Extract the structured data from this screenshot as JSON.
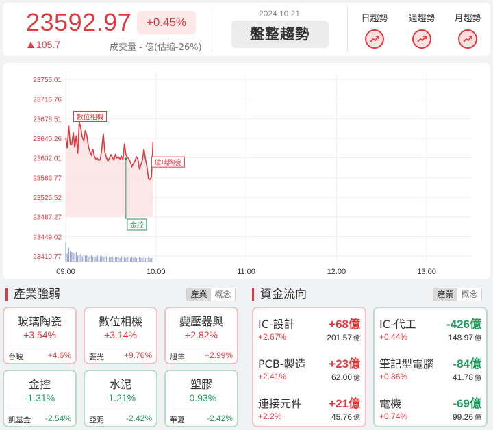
{
  "header": {
    "price": "23592.97",
    "change_pct": "+0.45%",
    "change": "105.7",
    "volume_text": "成交量 - 億(估縮-26%)",
    "date": "2024.10.21",
    "trend_label": "盤整趨勢",
    "trend_tabs": [
      {
        "label": "日趨勢"
      },
      {
        "label": "週趨勢"
      },
      {
        "label": "月趨勢"
      }
    ]
  },
  "colors": {
    "up": "#e0393e",
    "down": "#1f9a5c",
    "price_line": "#e0393e",
    "volume_bar": "#9aa6cf"
  },
  "chart_data": {
    "type": "line",
    "y_ticks": [
      "23755.01",
      "23716.76",
      "23678.51",
      "23640.26",
      "23602.01",
      "23563.77",
      "23525.52",
      "23487.27",
      "23449.02",
      "23410.77"
    ],
    "x_ticks": [
      "09:00",
      "10:00",
      "11:00",
      "12:00",
      "13:00"
    ],
    "ylim": [
      23410.77,
      23755.01
    ],
    "xlim": [
      0,
      270
    ],
    "series": [
      {
        "x": [
          0,
          1,
          2,
          3,
          4,
          5,
          6,
          7,
          8,
          9,
          10,
          11,
          12,
          13,
          14,
          15,
          16,
          17,
          18,
          19,
          20,
          21,
          22,
          23,
          24,
          25,
          26,
          27,
          28,
          29,
          30,
          31,
          32,
          33,
          34,
          35,
          36,
          37,
          38,
          39,
          40,
          41,
          42,
          43,
          44,
          45,
          46,
          47,
          48,
          49,
          50,
          51,
          52,
          53,
          54,
          55,
          56,
          57,
          58
        ],
        "values": [
          23641,
          23621,
          23665,
          23628,
          23628,
          23652,
          23622,
          23646,
          23610,
          23673,
          23660,
          23642,
          23635,
          23656,
          23647,
          23626,
          23615,
          23608,
          23620,
          23606,
          23600,
          23601,
          23597,
          23599,
          23620,
          23650,
          23613,
          23603,
          23596,
          23601,
          23608,
          23603,
          23598,
          23608,
          23602,
          23604,
          23600,
          23605,
          23598,
          23630,
          23608,
          23603,
          23600,
          23594,
          23585,
          23591,
          23596,
          23604,
          23600,
          23580,
          23589,
          23598,
          23620,
          23600,
          23585,
          23562,
          23560,
          23565,
          23633
        ]
      }
    ],
    "volume": [
      22,
      9,
      16,
      12,
      11,
      10,
      9,
      11,
      7,
      8,
      9,
      6,
      8,
      7,
      7,
      5,
      6,
      7,
      5,
      6,
      5,
      7,
      5,
      6,
      6,
      5,
      5,
      6,
      4,
      5,
      5,
      6,
      4,
      5,
      5,
      5,
      4,
      6,
      4,
      5,
      4,
      5,
      5,
      4,
      5,
      4,
      5,
      4,
      4,
      5,
      4,
      4,
      5,
      4,
      4,
      5,
      4,
      4,
      4
    ],
    "annotations": [
      {
        "label": "數位相機",
        "x": 8,
        "y": 23673
      },
      {
        "label": "玻璃陶瓷",
        "x": 58,
        "y": 23600
      },
      {
        "label": "金控",
        "x": 40,
        "y": 23600
      }
    ]
  },
  "industry": {
    "title": "產業強弱",
    "tabs": [
      "產業",
      "概念"
    ],
    "cards": [
      {
        "name": "玻璃陶瓷",
        "pct": "+3.54%",
        "stock": "台玻",
        "stock_pct": "+4.6%",
        "trend": "up"
      },
      {
        "name": "數位相機",
        "pct": "+3.14%",
        "stock": "菱光",
        "stock_pct": "+9.76%",
        "trend": "up"
      },
      {
        "name": "變壓器與",
        "pct": "+2.82%",
        "stock": "旭隼",
        "stock_pct": "+2.99%",
        "trend": "up"
      },
      {
        "name": "金控",
        "pct": "-1.31%",
        "stock": "凱基金",
        "stock_pct": "-2.54%",
        "trend": "down"
      },
      {
        "name": "水泥",
        "pct": "-1.21%",
        "stock": "亞泥",
        "stock_pct": "-2.42%",
        "trend": "down"
      },
      {
        "name": "塑膠",
        "pct": "-0.93%",
        "stock": "華夏",
        "stock_pct": "-2.42%",
        "trend": "down"
      }
    ]
  },
  "fund_flow": {
    "title": "資金流向",
    "tabs": [
      "產業",
      "概念"
    ],
    "unit": "億",
    "inflow": [
      {
        "name": "IC-設計",
        "amount": "+68億",
        "pct": "+2.67%",
        "volume": "201.57"
      },
      {
        "name": "PCB-製造",
        "amount": "+23億",
        "pct": "+2.41%",
        "volume": "62.00"
      },
      {
        "name": "連接元件",
        "amount": "+21億",
        "pct": "+2.2%",
        "volume": "45.76"
      }
    ],
    "outflow": [
      {
        "name": "IC-代工",
        "amount": "-426億",
        "pct": "+0.44%",
        "volume": "148.97"
      },
      {
        "name": "筆記型電腦",
        "amount": "-84億",
        "pct": "+0.86%",
        "volume": "41.78"
      },
      {
        "name": "電機",
        "amount": "-69億",
        "pct": "+0.74%",
        "volume": "99.26"
      }
    ]
  }
}
